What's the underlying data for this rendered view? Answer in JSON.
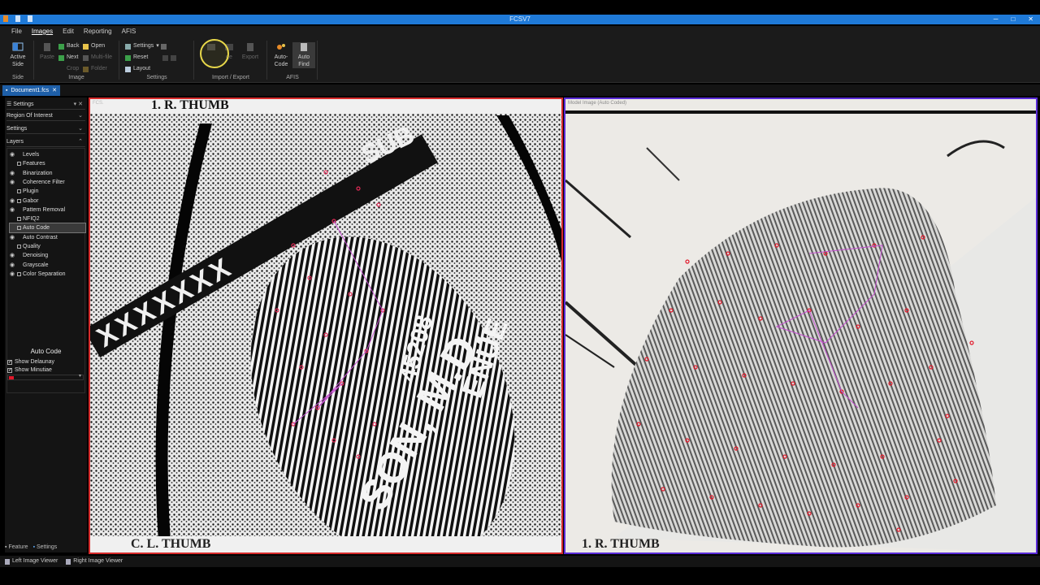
{
  "window": {
    "title": "FCSV7"
  },
  "menu": {
    "items": [
      "File",
      "Images",
      "Edit",
      "Reporting",
      "AFIS"
    ],
    "active": "Images"
  },
  "ribbon": {
    "side": {
      "active_side": "Active Side",
      "group": "Side"
    },
    "image": {
      "paste": "Paste",
      "back": "Back",
      "next": "Next",
      "crop": "Crop",
      "open": "Open",
      "multi_file": "Multi-file",
      "folder": "Folder",
      "group": "Image"
    },
    "settings": {
      "settings": "Settings",
      "reset": "Reset",
      "layout": "Layout",
      "group": "Settings"
    },
    "import_export": {
      "import_partial": "ge",
      "export": "Export",
      "group": "Import / Export"
    },
    "afis": {
      "auto_code": "Auto-Code",
      "auto_find": "Auto Find",
      "group": "AFIS"
    }
  },
  "document_tab": {
    "label": "Document1.fcs",
    "close": "✕"
  },
  "left_panel": {
    "settings_header": "Settings",
    "region_of_interest": "Region Of Interest",
    "settings": "Settings",
    "layers_header": "Layers",
    "layers": [
      {
        "name": "Levels",
        "eye": true,
        "checkbox": false
      },
      {
        "name": "Features",
        "eye": false,
        "checkbox": true
      },
      {
        "name": "Binarization",
        "eye": true,
        "checkbox": false
      },
      {
        "name": "Coherence Filter",
        "eye": true,
        "checkbox": false
      },
      {
        "name": "Plugin",
        "eye": false,
        "checkbox": true
      },
      {
        "name": "Gabor",
        "eye": true,
        "checkbox": true
      },
      {
        "name": "Pattern Removal",
        "eye": true,
        "checkbox": false
      },
      {
        "name": "NFIQ2",
        "eye": false,
        "checkbox": true
      },
      {
        "name": "Auto Code",
        "eye": false,
        "checkbox": true,
        "selected": true
      },
      {
        "name": "Auto Contrast",
        "eye": true,
        "checkbox": false
      },
      {
        "name": "Quality",
        "eye": false,
        "checkbox": true
      },
      {
        "name": "Denoising",
        "eye": true,
        "checkbox": false
      },
      {
        "name": "Grayscale",
        "eye": true,
        "checkbox": false
      },
      {
        "name": "Color Separation",
        "eye": true,
        "checkbox": true
      }
    ],
    "auto_code": {
      "title": "Auto Code",
      "show_delaunay": "Show Delaunay",
      "show_minutiae": "Show Minutiae",
      "color": "#e2182a"
    },
    "bottom_tabs": {
      "feature": "Feature",
      "settings": "Settings"
    }
  },
  "viewers": {
    "left": {
      "label": "FCS.",
      "header": "1. R. THUMB",
      "bottom": "C. L. THUMB",
      "side_number": "45208",
      "side_text": "ENUE",
      "big_text": "SON, M.D.",
      "sub_text": "SUB",
      "border_color": "#d62b2b"
    },
    "right": {
      "label": "Model Image (Auto Coded)",
      "bottom": "1. R. THUMB",
      "border_color": "#5a2bd8"
    }
  },
  "status_bar": {
    "left_viewer": "Left Image Viewer",
    "right_viewer": "Right Image Viewer"
  }
}
